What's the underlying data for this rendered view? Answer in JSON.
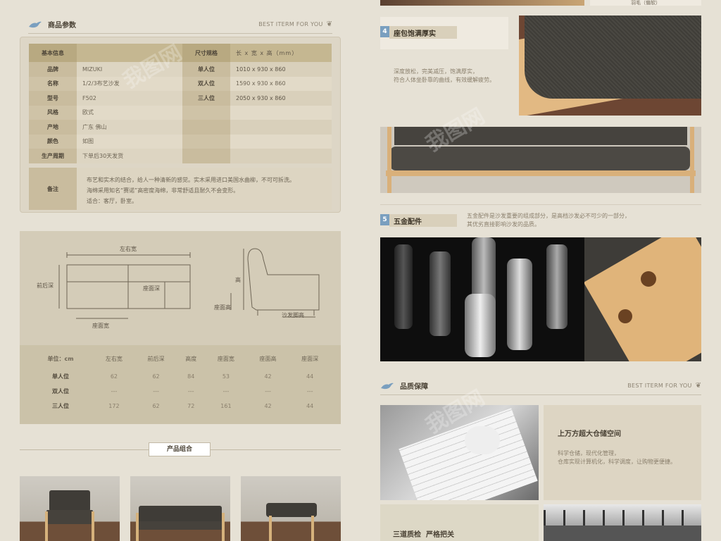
{
  "left": {
    "params_title": "商品参数",
    "params_tagline": "BEST ITERM FOR YOU",
    "spec_header": {
      "label": "基本信息",
      "size_label": "尺寸规格",
      "size_value": "长 x 宽 x 高（mm）"
    },
    "spec_rows": [
      {
        "label": "品牌",
        "value": "MIZUKI",
        "size_label": "单人位",
        "size_value": "1010 x 930 x 860"
      },
      {
        "label": "名称",
        "value": "1/2/3布艺沙发",
        "size_label": "双人位",
        "size_value": "1590 x 930 x 860"
      },
      {
        "label": "型号",
        "value": "F502",
        "size_label": "三人位",
        "size_value": "2050 x 930 x 860"
      },
      {
        "label": "风格",
        "value": "欧式",
        "size_label": "",
        "size_value": ""
      },
      {
        "label": "产地",
        "value": "广东 佛山",
        "size_label": "",
        "size_value": ""
      },
      {
        "label": "颜色",
        "value": "如图",
        "size_label": "",
        "size_value": ""
      },
      {
        "label": "生产周期",
        "value": "下单后30天发货",
        "size_label": "",
        "size_value": ""
      }
    ],
    "remark_label": "备注",
    "remark_lines": [
      "布艺和实木的结合，给人一种清新的感觉。实木采用进口美国水曲柳，不可可拆洗。",
      "海绵采用知名“赛诺”高密度海绵，非常舒适且耐久不会变形。",
      "适合：客厅，卧室。"
    ],
    "diagram_labels": {
      "width": "左右宽",
      "depth": "前后深",
      "seat_depth": "座面深",
      "seat_width": "座面宽",
      "height": "高",
      "seat_height": "座面高",
      "foot_height": "沙发脚高"
    },
    "dim_header": [
      "单位：cm",
      "左右宽",
      "前后深",
      "高度",
      "座面宽",
      "座面高",
      "座面深"
    ],
    "dim_rows": [
      [
        "单人位",
        "62",
        "62",
        "84",
        "53",
        "42",
        "44"
      ],
      [
        "双人位",
        "---",
        "---",
        "---",
        "---",
        "---",
        "---"
      ],
      [
        "三人位",
        "172",
        "62",
        "72",
        "161",
        "42",
        "44"
      ]
    ],
    "combo_title": "产品组合"
  },
  "right": {
    "top_caption": "羽毛（偏软）",
    "s4": {
      "num": "4",
      "title": "座包饱满厚实",
      "lines": [
        "深度放松，完美减压，饱满厚实，",
        "符合人体坐卧靠的曲线，有效缓解疲劳。"
      ]
    },
    "s5": {
      "num": "5",
      "title": "五金配件",
      "lines": [
        "五金配件是沙发重要的组成部分，是高档沙发必不可少的一部分，",
        "其优劣直接影响沙发的品质。"
      ]
    },
    "quality_title": "品质保障",
    "quality_tagline": "BEST ITERM FOR YOU",
    "warehouse_title": "上万方超大仓储空间",
    "warehouse_lines": [
      "科学仓储，现代化管理，",
      "仓库实现计算机化，科学调度，让购物更便捷。"
    ],
    "inspect_title": "三道质检  严格把关"
  },
  "watermark": "我图网",
  "colors": {
    "accent_blue": "#7a9fbf",
    "panel": "#d4ccb8",
    "header_band": "#b8a981"
  }
}
